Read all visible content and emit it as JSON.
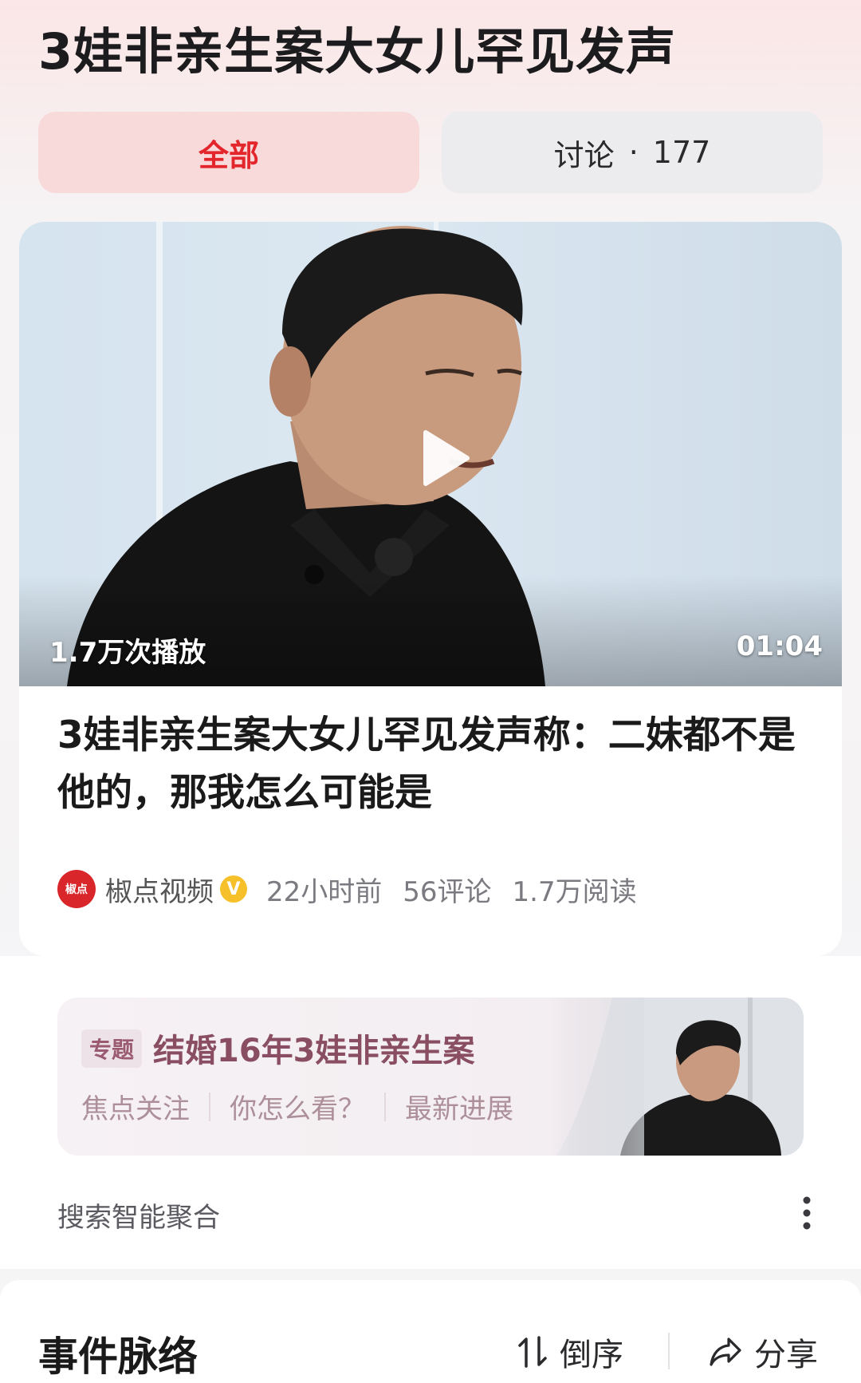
{
  "header": {
    "title": "3娃非亲生案大女儿罕见发声"
  },
  "tabs": [
    {
      "label": "全部",
      "active": true
    },
    {
      "label": "讨论",
      "count": "177"
    }
  ],
  "video_card": {
    "views": "1.7万次播放",
    "duration": "01:04",
    "title": "3娃非亲生案大女儿罕见发声称：二妹都不是他的，那我怎么可能是",
    "source": {
      "avatar_text": "椒点",
      "name": "椒点视频",
      "verified": true,
      "verified_icon": "V"
    },
    "time": "22小时前",
    "comments": "56评论",
    "reads": "1.7万阅读"
  },
  "topic": {
    "badge": "专题",
    "title": "结婚16年3娃非亲生案",
    "links": [
      "焦点关注",
      "你怎么看？",
      "最新进展"
    ]
  },
  "ai_summary": {
    "label": "搜索智能聚合"
  },
  "timeline": {
    "title": "事件脉络",
    "sort_label": "倒序",
    "share_label": "分享"
  },
  "colors": {
    "accent": "#e2262c",
    "tab_active_bg": "#f8dada",
    "topic_text": "#8a4e62",
    "verified": "#f5c02a"
  }
}
